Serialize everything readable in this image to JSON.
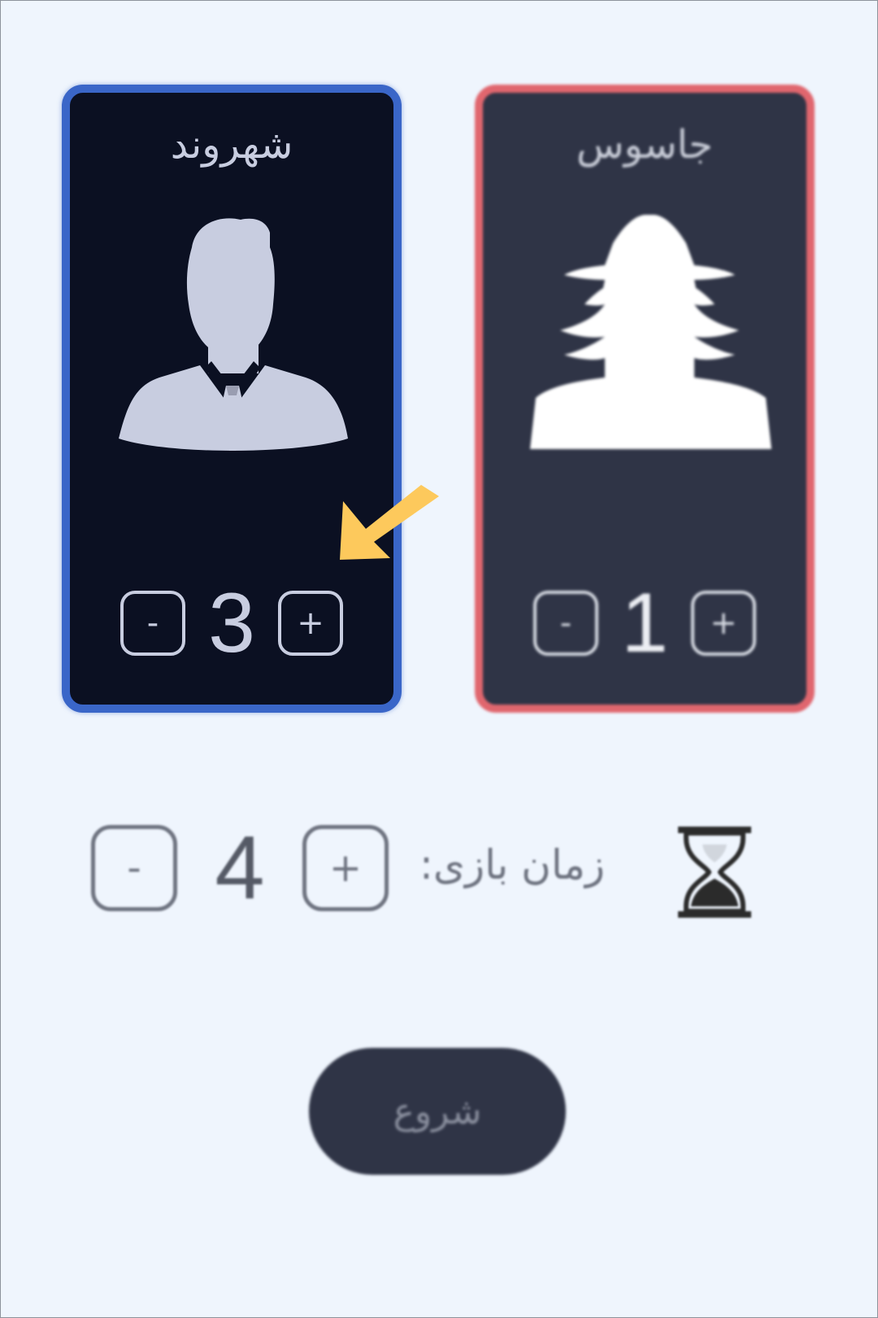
{
  "roles": {
    "citizen": {
      "title": "شهروند",
      "count": "3",
      "minus_label": "-",
      "plus_label": "+",
      "border_color": "#3a66c8"
    },
    "spy": {
      "title": "جاسوس",
      "count": "1",
      "minus_label": "-",
      "plus_label": "+",
      "border_color": "#e0666e"
    }
  },
  "game_time": {
    "label": "زمان بازی:",
    "value": "4",
    "minus_label": "-",
    "plus_label": "+",
    "icon": "hourglass-icon"
  },
  "start_button": {
    "label": "شروع"
  },
  "hint": {
    "icon": "arrow-hint-icon",
    "color": "#fdc95c"
  }
}
